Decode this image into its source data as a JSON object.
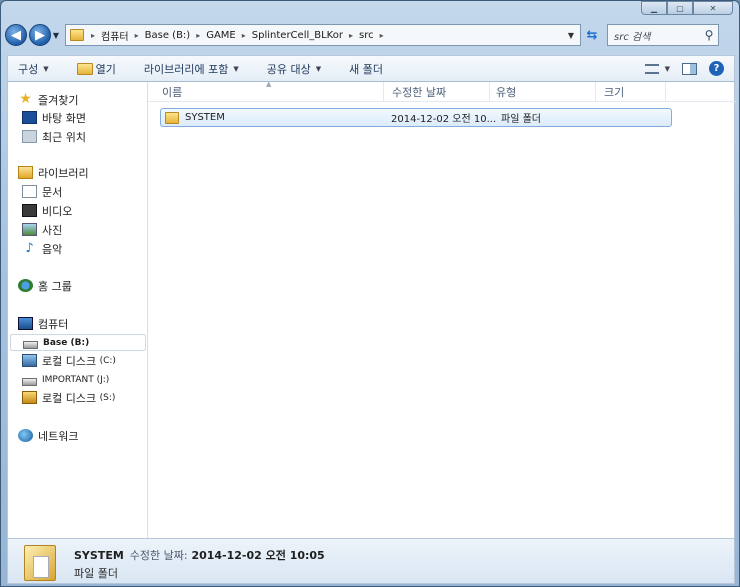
{
  "window": {
    "caption_buttons": [
      "minimize-icon",
      "maximize-icon",
      "close-icon"
    ]
  },
  "address": {
    "crumbs": [
      "컴퓨터",
      "Base (B:)",
      "GAME",
      "SplinterCell_BLKor",
      "src"
    ],
    "search_placeholder": "src 검색"
  },
  "toolbar": {
    "organize": "구성",
    "open": "열기",
    "include_in_library": "라이브러리에 포함",
    "share_with": "공유 대상",
    "new_folder": "새 폴더"
  },
  "sidebar": {
    "favorites": "즐겨찾기",
    "desktop": "바탕 화면",
    "recent": "최근 위치",
    "libraries": "라이브러리",
    "documents": "문서",
    "videos": "비디오",
    "pictures": "사진",
    "music": "음악",
    "homegroup": "홈 그룹",
    "computer": "컴퓨터",
    "drive_b": "Base (B:)",
    "drive_c_name": "로컬 디스크",
    "drive_c_letter": "(C:)",
    "drive_j": "IMPORTANT (J:)",
    "drive_s_name": "로컬 디스크",
    "drive_s_letter": "(S:)",
    "network": "네트워크"
  },
  "columns": {
    "name": "이름",
    "modified": "수정한 날짜",
    "type": "유형",
    "size": "크기"
  },
  "files": [
    {
      "name": "SYSTEM",
      "modified": "2014-12-02 오전 10...",
      "type": "파일 폴더",
      "size": ""
    }
  ],
  "details": {
    "name": "SYSTEM",
    "modified_label": "수정한 날짜:",
    "modified_value": "2014-12-02 오전 10:05",
    "type": "파일 폴더"
  }
}
